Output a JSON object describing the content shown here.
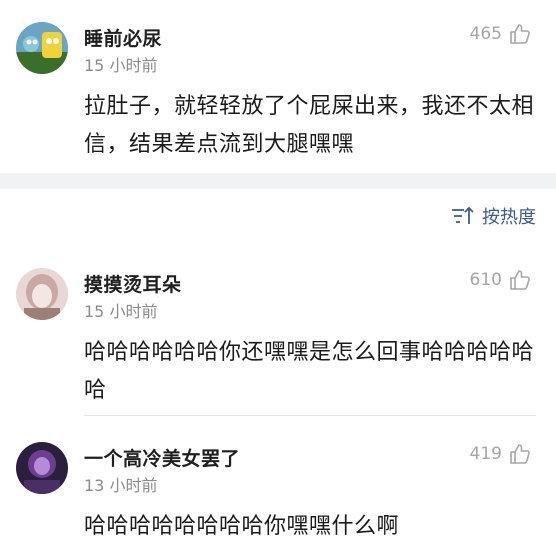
{
  "posts": [
    {
      "username": "睡前必尿",
      "time": "15 小时前",
      "likes": "465",
      "content": "拉肚子，就轻轻放了个屁屎出来，我还不太相信，结果差点流到大腿嘿嘿",
      "avatar_colors": [
        "#6aa5c6",
        "#f2d23a",
        "#3b6d2b"
      ]
    },
    {
      "username": "摸摸烫耳朵",
      "time": "15 小时前",
      "likes": "610",
      "content": "哈哈哈哈哈哈你还嘿嘿是怎么回事哈哈哈哈哈哈",
      "avatar_colors": [
        "#e8d7d5",
        "#c9a9a3",
        "#9d7e79"
      ]
    },
    {
      "username": "一个高冷美女罢了",
      "time": "13 小时前",
      "likes": "419",
      "content": "哈哈哈哈哈哈哈哈你嘿嘿什么啊",
      "avatar_colors": [
        "#2c1f3d",
        "#6b3f8e",
        "#b58ad6"
      ]
    }
  ],
  "sort": {
    "label": "按热度",
    "icon": "sort-icon"
  },
  "colors": {
    "accent": "#3d5c8c",
    "muted": "#8c8c8c",
    "separator": "#f1f2f4"
  }
}
